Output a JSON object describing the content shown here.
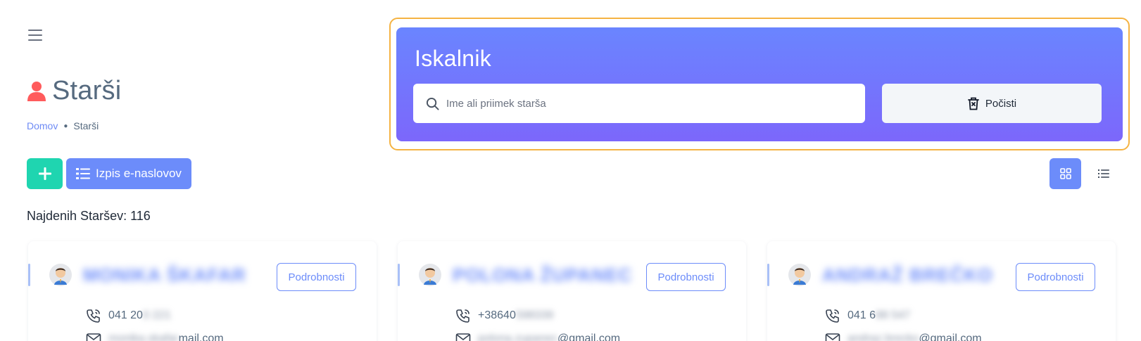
{
  "header": {
    "title": "Starši",
    "breadcrumb": {
      "home": "Domov",
      "current": "Starši"
    }
  },
  "search": {
    "title": "Iskalnik",
    "placeholder": "Ime ali priimek starša",
    "value": "",
    "clear_label": "Počisti"
  },
  "toolbar": {
    "emails_label": "Izpis e-naslovov"
  },
  "results": {
    "found_label": "Najdenih Staršev: 116"
  },
  "cards": [
    {
      "name": "MONIKA ŠKAFAR",
      "details_label": "Podrobnosti",
      "phone_visible": "041 20",
      "phone_masked": "0 221",
      "email_masked": "monika.skafar",
      "email_visible": "mail.com"
    },
    {
      "name": "POLONA ŽUPANEC",
      "details_label": "Podrobnosti",
      "phone_visible": "+38640",
      "phone_masked": "598339",
      "email_masked": "polona.zupanec",
      "email_visible": "@gmail.com"
    },
    {
      "name": "ANDRAŽ BREČKO",
      "details_label": "Podrobnosti",
      "phone_visible": "041 6",
      "phone_masked": "88 547",
      "email_masked": "andraz.brecko",
      "email_visible": "@gmail.com"
    }
  ],
  "colors": {
    "accent": "#6c8cfa",
    "add_button": "#1fd5b0",
    "title_icon": "#ff5b5c",
    "search_highlight": "#f5b342"
  }
}
